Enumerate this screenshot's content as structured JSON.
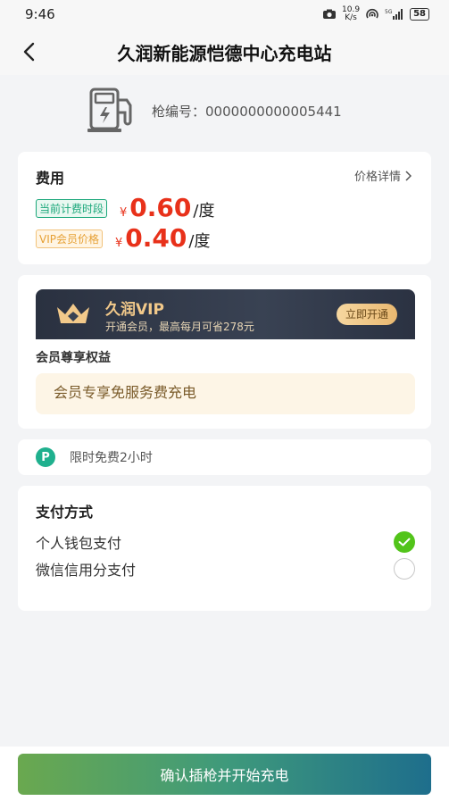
{
  "status_bar": {
    "time": "9:46",
    "net_speed_value": "10.9",
    "net_speed_unit": "K/s",
    "battery": "58"
  },
  "header": {
    "title": "久润新能源恺德中心充电站"
  },
  "gun": {
    "label": "枪编号：",
    "number": "0000000000005441"
  },
  "fee": {
    "title": "费用",
    "price_detail": "价格详情",
    "current_tag": "当前计费时段",
    "current_price": "0.60",
    "vip_tag": "VIP会员价格",
    "vip_price": "0.40",
    "currency": "¥",
    "unit": "/度"
  },
  "vip": {
    "name": "久润VIP",
    "desc": "开通会员，最高每月可省278元",
    "open_button": "立即开通",
    "benefit_title": "会员尊享权益",
    "benefit_text": "会员专享免服务费充电"
  },
  "parking": {
    "icon_letter": "P",
    "text": "限时免费2小时"
  },
  "payment": {
    "title": "支付方式",
    "options": [
      {
        "label": "个人钱包支付",
        "selected": true
      },
      {
        "label": "微信信用分支付",
        "selected": false
      }
    ]
  },
  "confirm_button": "确认插枪并开始充电",
  "colors": {
    "price_red": "#e8311a",
    "green_tag": "#1aa77a",
    "check_green": "#52c41a"
  }
}
